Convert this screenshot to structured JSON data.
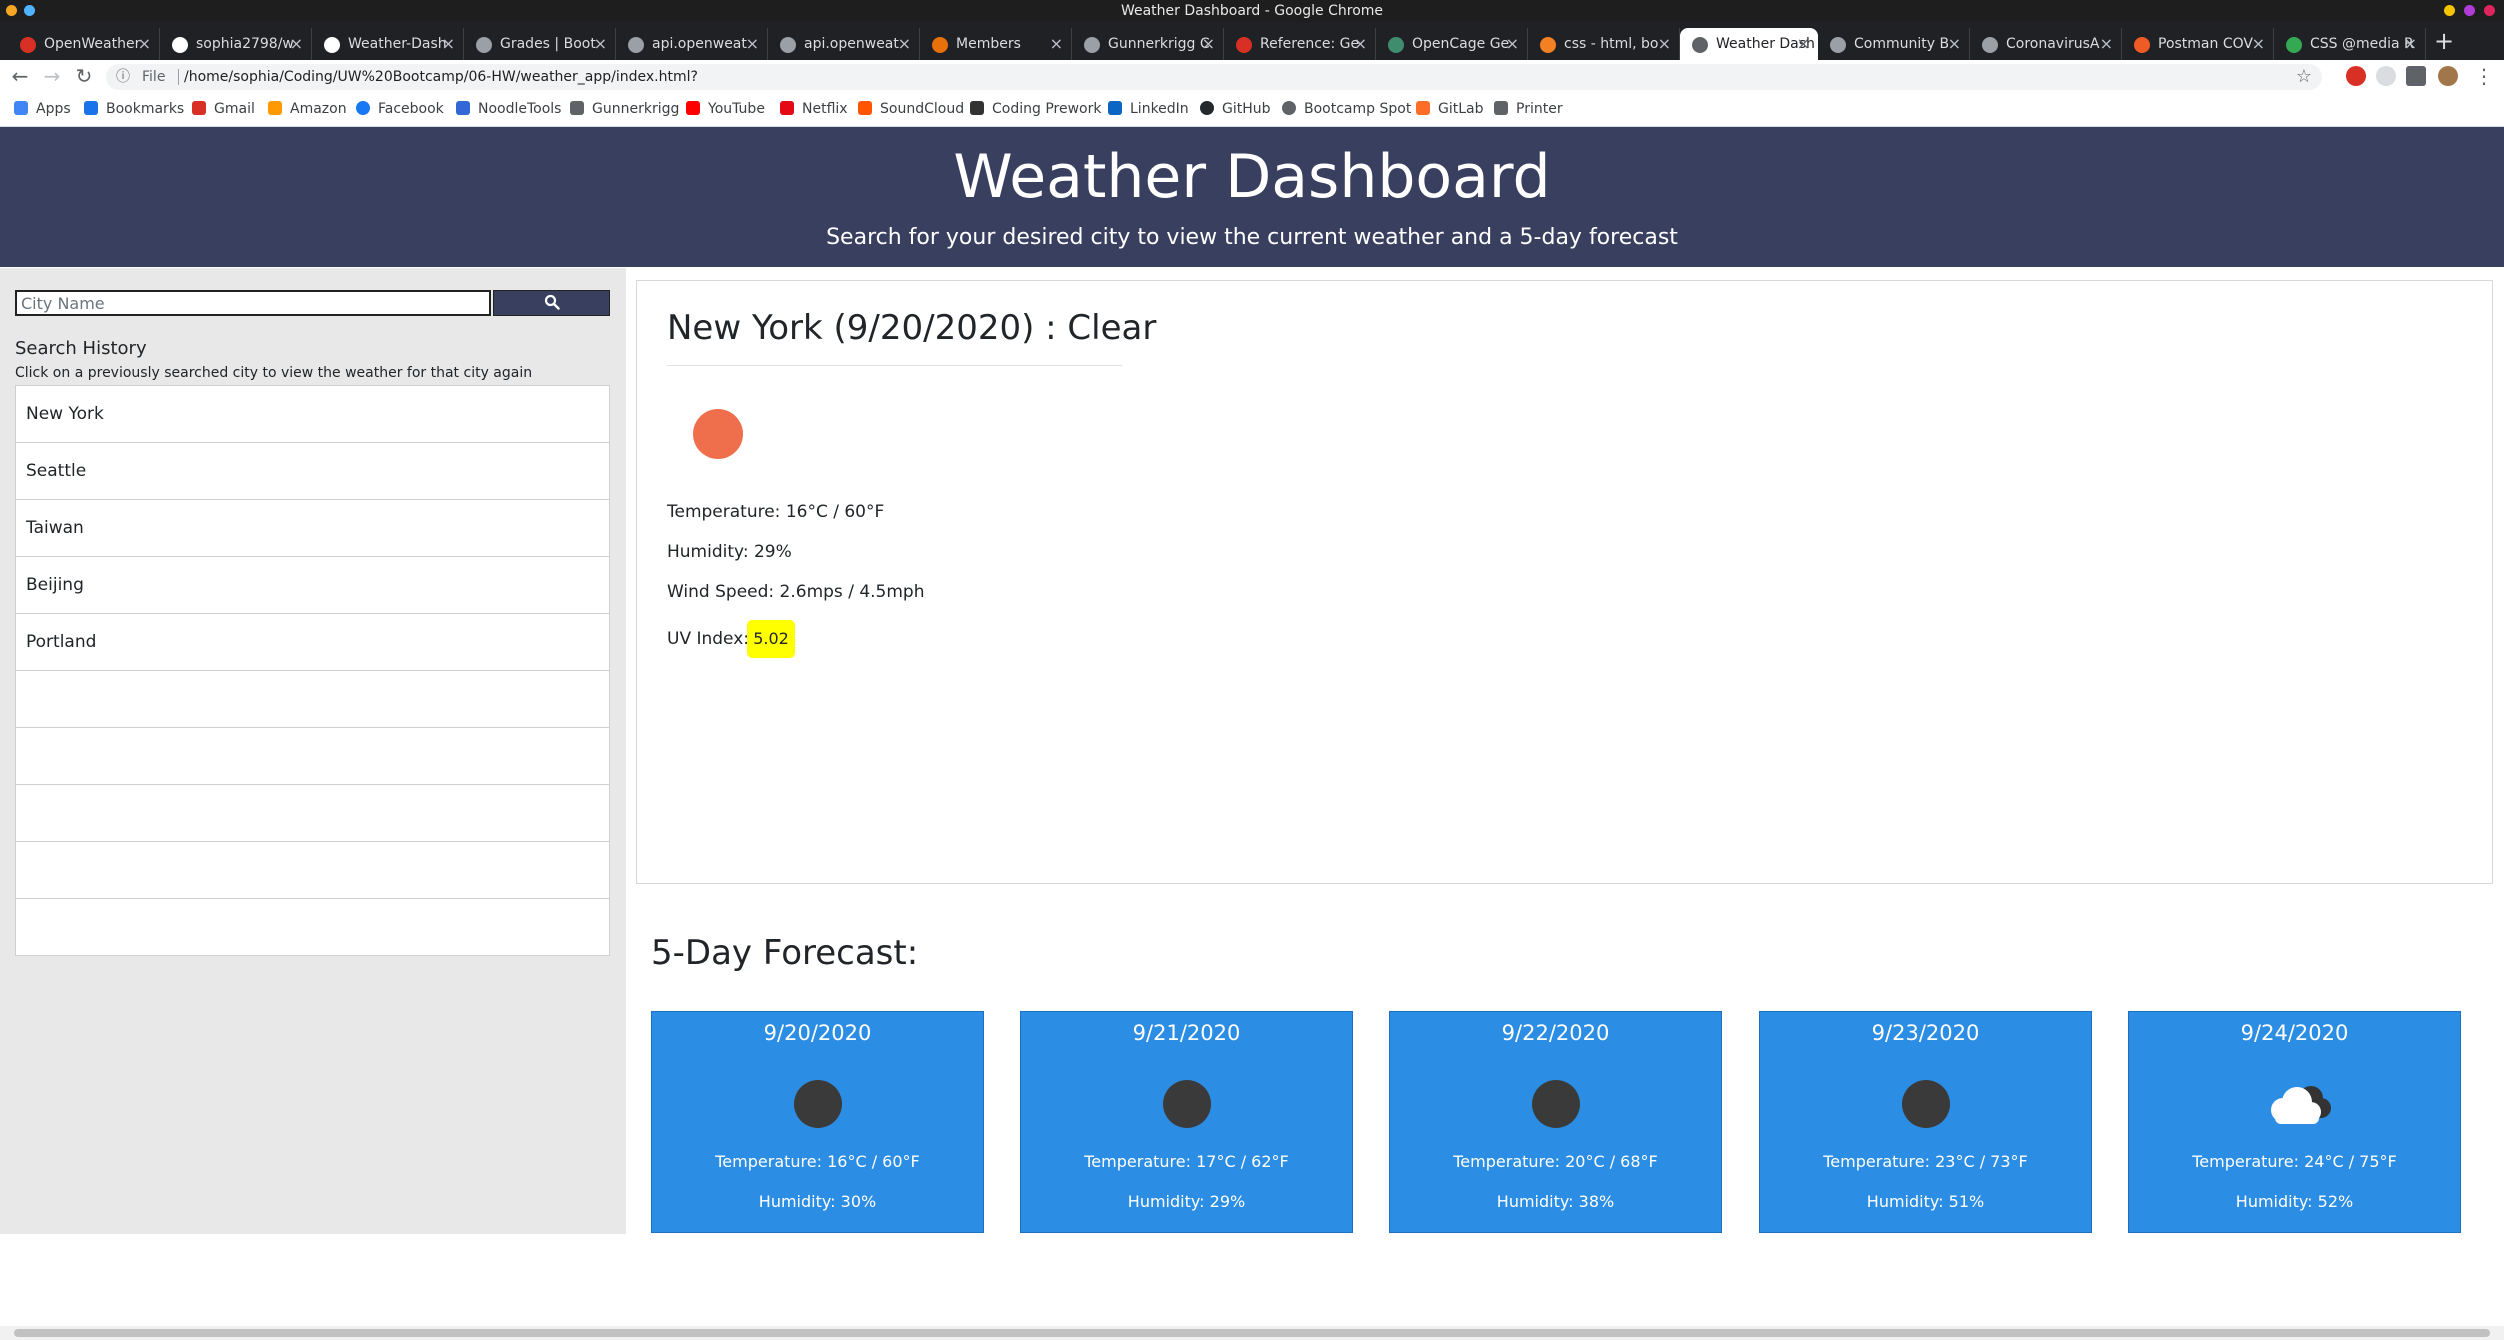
{
  "window": {
    "title": "Weather Dashboard - Google Chrome"
  },
  "tabs": [
    {
      "label": "OpenWeather",
      "color": "#d93025"
    },
    {
      "label": "sophia2798/w",
      "color": "#ffffff"
    },
    {
      "label": "Weather-Dash",
      "color": "#ffffff"
    },
    {
      "label": "Grades | Boot",
      "color": "#9aa0a6"
    },
    {
      "label": "api.openweat",
      "color": "#9aa0a6"
    },
    {
      "label": "api.openweat",
      "color": "#9aa0a6"
    },
    {
      "label": "Members",
      "color": "#e8710a"
    },
    {
      "label": "Gunnerkrigg C",
      "color": "#9aa0a6"
    },
    {
      "label": "Reference: Ge",
      "color": "#d93025"
    },
    {
      "label": "OpenCage Ge",
      "color": "#3f8c6e"
    },
    {
      "label": "css - html, bo",
      "color": "#f48024"
    },
    {
      "label": "Weather Dash",
      "color": "#9aa0a6"
    },
    {
      "label": "Community B",
      "color": "#9aa0a6"
    },
    {
      "label": "CoronavirusA",
      "color": "#9aa0a6"
    },
    {
      "label": "Postman COV",
      "color": "#ef5b25"
    },
    {
      "label": "CSS @media R",
      "color": "#34a853"
    }
  ],
  "toolbar": {
    "scheme": "File",
    "url": "/home/sophia/Coding/UW%20Bootcamp/06-HW/weather_app/index.html?"
  },
  "bookmarks": [
    {
      "label": "Apps",
      "color": "#4285f4"
    },
    {
      "label": "Bookmarks",
      "color": "#1a73e8"
    },
    {
      "label": "Gmail",
      "color": "#d93025"
    },
    {
      "label": "Amazon",
      "color": "#ff9900"
    },
    {
      "label": "Facebook",
      "color": "#1877f2"
    },
    {
      "label": "NoodleTools",
      "color": "#3367d6"
    },
    {
      "label": "Gunnerkrigg",
      "color": "#5f6368"
    },
    {
      "label": "YouTube",
      "color": "#ff0000"
    },
    {
      "label": "Netflix",
      "color": "#e50914"
    },
    {
      "label": "SoundCloud",
      "color": "#ff5500"
    },
    {
      "label": "Coding Prework",
      "color": "#333333"
    },
    {
      "label": "LinkedIn",
      "color": "#0a66c2"
    },
    {
      "label": "GitHub",
      "color": "#24292e"
    },
    {
      "label": "Bootcamp Spot",
      "color": "#5f6368"
    },
    {
      "label": "GitLab",
      "color": "#fc6d26"
    },
    {
      "label": "Printer",
      "color": "#5f6368"
    }
  ],
  "header": {
    "title": "Weather Dashboard",
    "subtitle": "Search for your desired city to view the current weather and a 5-day forecast"
  },
  "search": {
    "placeholder": "City Name",
    "value": ""
  },
  "history": {
    "title": "Search History",
    "description": "Click on a previously searched city to view the weather for that city again",
    "items": [
      "New York",
      "Seattle",
      "Taiwan",
      "Beijing",
      "Portland",
      "",
      "",
      "",
      "",
      ""
    ]
  },
  "current": {
    "heading": "New York (9/20/2020) : Clear",
    "temperature": "Temperature: 16°C / 60°F",
    "humidity": "Humidity: 29%",
    "wind": "Wind Speed: 2.6mps / 4.5mph",
    "uv_label": "UV Index:",
    "uv_value": "5.02",
    "icon": "clear-sun-icon"
  },
  "forecast": {
    "title": "5-Day Forecast:",
    "days": [
      {
        "date": "9/20/2020",
        "temp": "Temperature: 16°C / 60°F",
        "humidity": "Humidity: 30%",
        "icon": "clear-icon"
      },
      {
        "date": "9/21/2020",
        "temp": "Temperature: 17°C / 62°F",
        "humidity": "Humidity: 29%",
        "icon": "clear-icon"
      },
      {
        "date": "9/22/2020",
        "temp": "Temperature: 20°C / 68°F",
        "humidity": "Humidity: 38%",
        "icon": "clear-icon"
      },
      {
        "date": "9/23/2020",
        "temp": "Temperature: 23°C / 73°F",
        "humidity": "Humidity: 51%",
        "icon": "clear-icon"
      },
      {
        "date": "9/24/2020",
        "temp": "Temperature: 24°C / 75°F",
        "humidity": "Humidity: 52%",
        "icon": "cloud-icon"
      }
    ]
  },
  "colors": {
    "header_bg": "#393f5f",
    "card_blue": "#2b8de3",
    "uv_badge": "#ffff00",
    "sun": "#ef6e4b"
  }
}
